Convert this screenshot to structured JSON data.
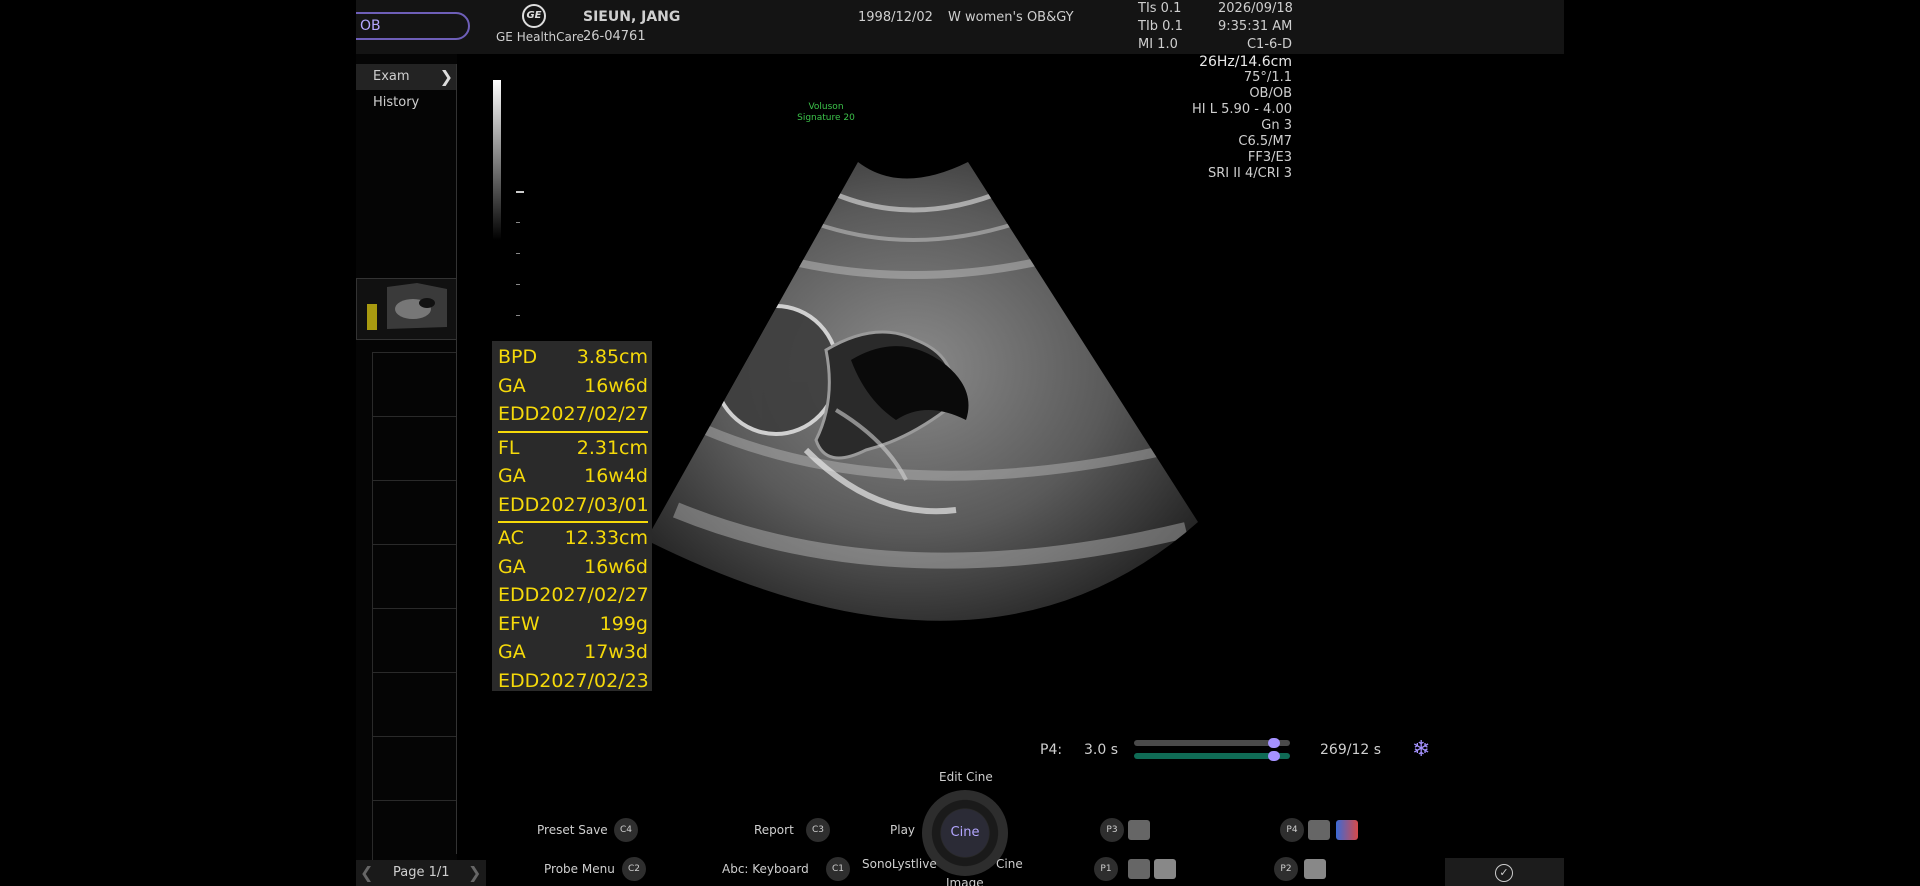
{
  "header": {
    "preset": "OB",
    "brand": "GE HealthCare",
    "patient_name": "SIEUN, JANG",
    "patient_id": "26-04761",
    "birth_date": "1998/12/02",
    "institution": "W women's OB&GY",
    "tis": "TIs 0.1",
    "tib": "TIb 0.1",
    "mi": "MI  1.0",
    "date": "2026/09/18",
    "time": "9:35:31 AM",
    "probe": "C1-6-D"
  },
  "imaging_params": [
    "26Hz/14.6cm",
    "75°/1.1",
    "OB/OB",
    "HI L  5.90 - 4.00",
    "Gn  3",
    "C6.5/M7",
    "FF3/E3",
    "SRI II 4/CRI 3"
  ],
  "left_panel": {
    "exam_history": "Exam History",
    "page": "Page 1/1"
  },
  "watermark": {
    "line1": "Voluson",
    "line2": "Signature 20"
  },
  "measurements": [
    {
      "label": "BPD",
      "value": "3.85cm"
    },
    {
      "label": "GA",
      "value": "16w6d"
    },
    {
      "label": "EDD",
      "value": "2027/02/27"
    },
    {
      "label": "FL",
      "value": "2.31cm"
    },
    {
      "label": "GA",
      "value": "16w4d"
    },
    {
      "label": "EDD",
      "value": "2027/03/01"
    },
    {
      "label": "AC",
      "value": "12.33cm"
    },
    {
      "label": "GA",
      "value": "16w6d"
    },
    {
      "label": "EDD",
      "value": "2027/02/27"
    },
    {
      "label": "EFW",
      "value": "199g"
    },
    {
      "label": "GA",
      "value": "17w3d"
    },
    {
      "label": "EDD",
      "value": "2027/02/23"
    }
  ],
  "cine": {
    "preset_key": "P4:",
    "duration": "3.0 s",
    "frames": "269/12 s",
    "frozen_icon": "snowflake-icon",
    "progress": 0.93
  },
  "controls": {
    "preset_save": "Preset Save",
    "c4": "C4",
    "report": "Report",
    "c3": "C3",
    "play": "Play",
    "edit_cine": "Edit Cine",
    "cine": "Cine",
    "cine_lower": "Cine",
    "sonolyst": "SonoLystlive",
    "image": "Image",
    "probe_menu": "Probe Menu",
    "c2": "C2",
    "keyboard": "Abc: Keyboard",
    "c1": "C1",
    "p3": "P3",
    "p4": "P4",
    "p1": "P1",
    "p2": "P2"
  }
}
